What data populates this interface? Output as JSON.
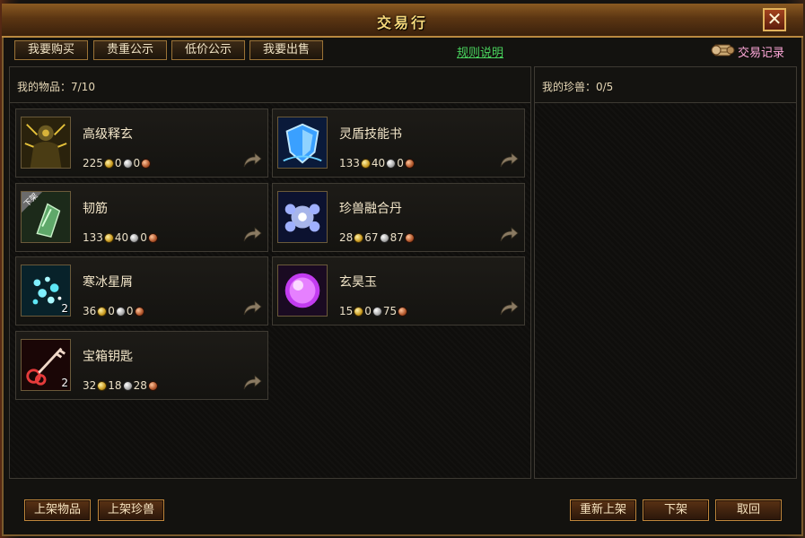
{
  "window": {
    "title": "交易行",
    "close_label": "✕"
  },
  "tabs": [
    {
      "label": "我要购买"
    },
    {
      "label": "贵重公示"
    },
    {
      "label": "低价公示"
    },
    {
      "label": "我要出售"
    }
  ],
  "rules_link": "规则说明",
  "records_label": "交易记录",
  "items_panel": {
    "label": "我的物品：7/10"
  },
  "pets_panel": {
    "label": "我的珍兽：0/5"
  },
  "items": [
    {
      "name": "高级释玄",
      "qty": "",
      "gold": "225",
      "silver": "0",
      "copper": "0",
      "icon": "warrior-icon"
    },
    {
      "name": "灵盾技能书",
      "qty": "",
      "gold": "133",
      "silver": "40",
      "copper": "0",
      "icon": "shield-skill-book-icon"
    },
    {
      "name": "韧筋",
      "qty": "",
      "gold": "133",
      "silver": "40",
      "copper": "0",
      "icon": "tendon-icon",
      "badge": "下架"
    },
    {
      "name": "珍兽融合丹",
      "qty": "",
      "gold": "28",
      "silver": "67",
      "copper": "87",
      "icon": "fusion-pill-icon"
    },
    {
      "name": "寒冰星屑",
      "qty": "2",
      "gold": "36",
      "silver": "0",
      "copper": "0",
      "icon": "ice-stardust-icon"
    },
    {
      "name": "玄昊玉",
      "qty": "",
      "gold": "15",
      "silver": "0",
      "copper": "75",
      "icon": "purple-jade-icon"
    },
    {
      "name": "宝箱钥匙",
      "qty": "2",
      "gold": "32",
      "silver": "18",
      "copper": "28",
      "icon": "treasure-key-icon"
    }
  ],
  "buttons": {
    "list_item": "上架物品",
    "list_pet": "上架珍兽",
    "relist": "重新上架",
    "delist": "下架",
    "cancel": "取回"
  }
}
